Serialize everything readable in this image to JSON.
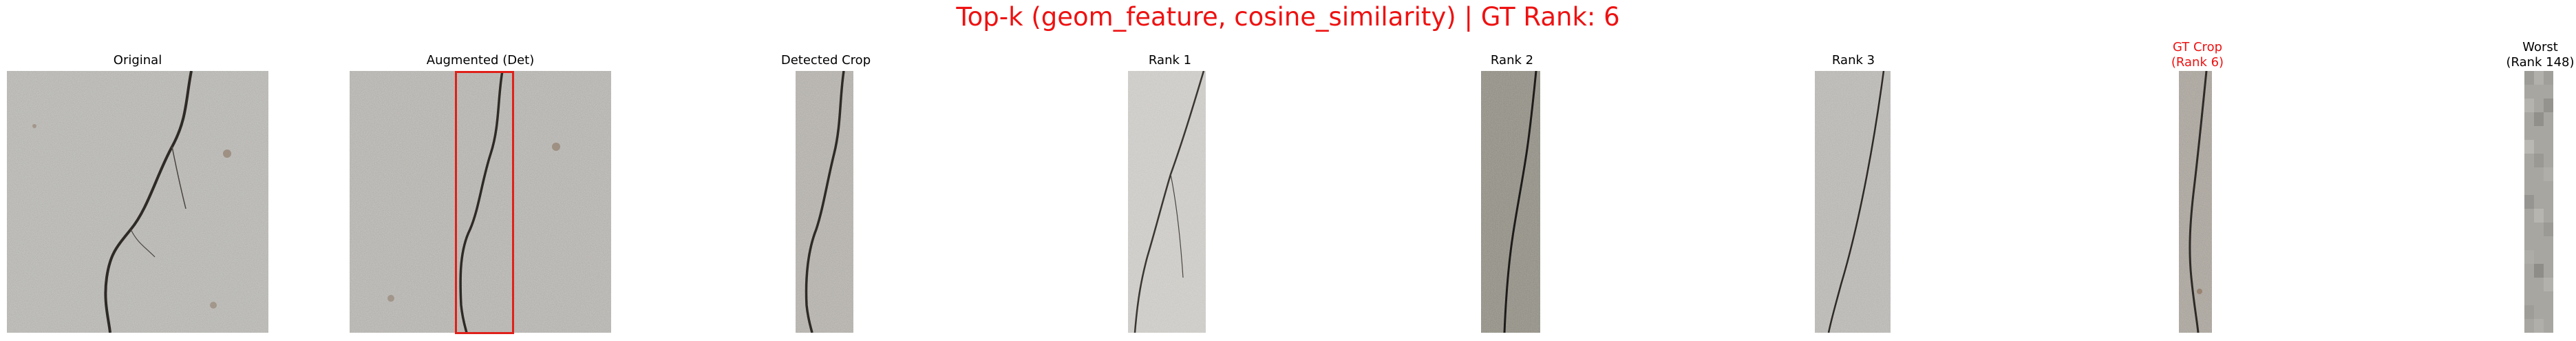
{
  "figure": {
    "title": "Top-k (geom_feature, cosine_similarity) | GT Rank: 6",
    "title_color": "#ee1111"
  },
  "panels": [
    {
      "title": "Original"
    },
    {
      "title": "Augmented (Det)",
      "box_color": "#e0201a"
    },
    {
      "title": "Detected Crop"
    },
    {
      "title": "Rank 1"
    },
    {
      "title": "Rank 2"
    },
    {
      "title": "Rank 3"
    },
    {
      "title_line1": "GT Crop",
      "title_line2": "(Rank 6)",
      "title_color": "#ee1111"
    },
    {
      "title_line1": "Worst",
      "title_line2": "(Rank 148)"
    }
  ]
}
